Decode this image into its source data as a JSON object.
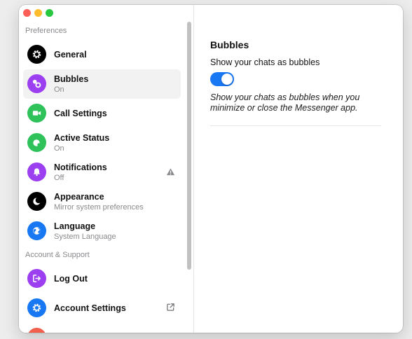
{
  "window": {
    "traffic_lights": [
      "close",
      "minimize",
      "zoom"
    ]
  },
  "sidebar": {
    "section_preferences": "Preferences",
    "section_account": "Account & Support",
    "items": [
      {
        "title": "General",
        "subtitle": "",
        "icon": "gear-icon",
        "icon_color": "#000000",
        "selected": false
      },
      {
        "title": "Bubbles",
        "subtitle": "On",
        "icon": "bubbles-icon",
        "icon_color": "#9b3ff0",
        "selected": true
      },
      {
        "title": "Call Settings",
        "subtitle": "",
        "icon": "video-camera-icon",
        "icon_color": "#2fc25b",
        "selected": false
      },
      {
        "title": "Active Status",
        "subtitle": "On",
        "icon": "active-status-icon",
        "icon_color": "#2fc25b",
        "selected": false
      },
      {
        "title": "Notifications",
        "subtitle": "Off",
        "icon": "bell-icon",
        "icon_color": "#9b3ff0",
        "selected": false,
        "trailing": "warning-icon"
      },
      {
        "title": "Appearance",
        "subtitle": "Mirror system preferences",
        "icon": "moon-icon",
        "icon_color": "#000000",
        "selected": false
      },
      {
        "title": "Language",
        "subtitle": "System Language",
        "icon": "globe-icon",
        "icon_color": "#1877f2",
        "selected": false
      },
      {
        "title": "Log Out",
        "subtitle": "",
        "icon": "logout-icon",
        "icon_color": "#9b3ff0",
        "selected": false
      },
      {
        "title": "Account Settings",
        "subtitle": "",
        "icon": "gear-icon",
        "icon_color": "#1877f2",
        "selected": false,
        "trailing": "external-link-icon"
      }
    ]
  },
  "main": {
    "heading": "Bubbles",
    "setting_label": "Show your chats as bubbles",
    "toggle_on": true,
    "description": "Show your chats as bubbles when you minimize or close the Messenger app."
  },
  "colors": {
    "accent": "#1877f2",
    "selected_bg": "#f2f2f2"
  }
}
